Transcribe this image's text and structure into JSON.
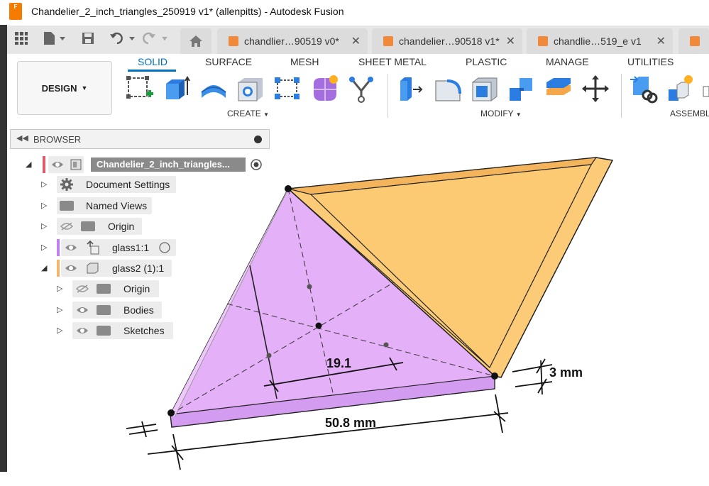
{
  "window": {
    "title": "Chandelier_2_inch_triangles_250919 v1* (allenpitts) - Autodesk Fusion",
    "app_icon_letter": "F"
  },
  "doc_tabs": [
    {
      "label": "chandlier…90519 v0*",
      "close": "✕"
    },
    {
      "label": "chandelier…90518 v1*",
      "close": "✕"
    },
    {
      "label": "chandlie…519_e v1",
      "close": "✕"
    }
  ],
  "ribbon": {
    "workspace": "DESIGN",
    "tabs": [
      "SOLID",
      "SURFACE",
      "MESH",
      "SHEET METAL",
      "PLASTIC",
      "MANAGE",
      "UTILITIES"
    ],
    "groups": {
      "create": "CREATE",
      "modify": "MODIFY",
      "assemble": "ASSEMBLE"
    }
  },
  "browser": {
    "title": "BROWSER",
    "root": "Chandelier_2_inch_triangles...",
    "items": {
      "document_settings": "Document Settings",
      "named_views": "Named Views",
      "origin": "Origin",
      "glass1": "glass1:1",
      "glass2": "glass2 (1):1",
      "glass2_origin": "Origin",
      "bodies": "Bodies",
      "sketches": "Sketches"
    }
  },
  "dimensions": {
    "inner": "19.1",
    "thickness": "3 mm",
    "base": "50.8 mm"
  },
  "colors": {
    "purple_body": "#e4b0f7",
    "orange_body": "#fbcb78",
    "accent_blue": "#0070c0",
    "glass1_bar": "#c37ef5",
    "glass2_bar": "#f5b46a",
    "root_bar": "#e05a6a"
  }
}
